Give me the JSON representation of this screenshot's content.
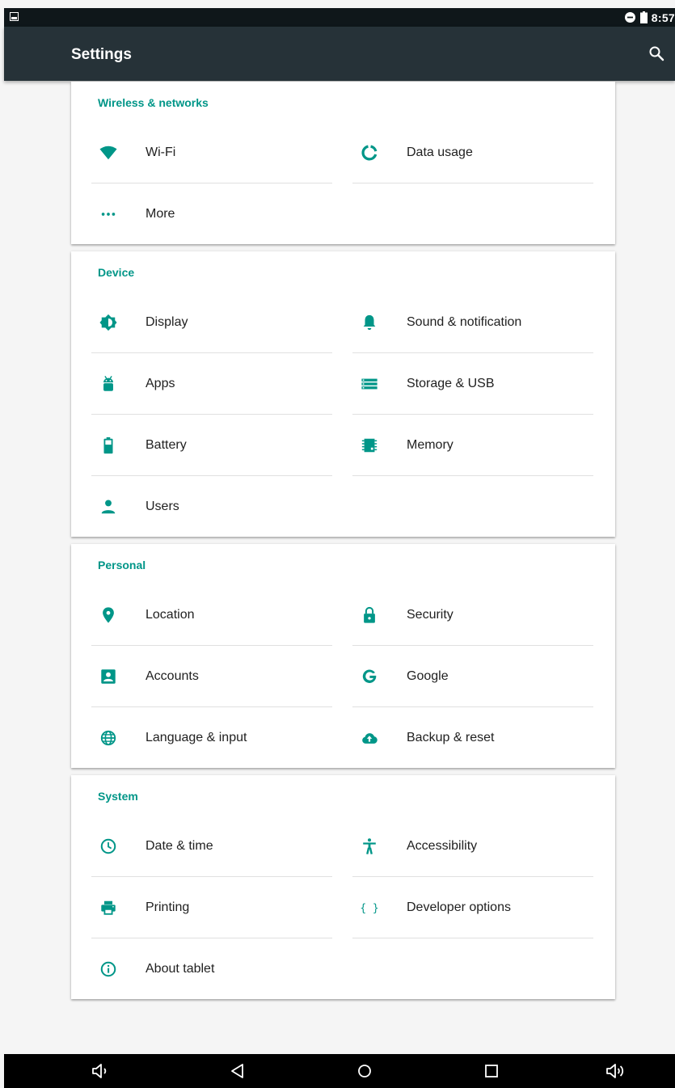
{
  "status_bar": {
    "time": "8:57",
    "icons": [
      "image-icon",
      "do-not-disturb-icon",
      "battery-icon"
    ]
  },
  "app_bar": {
    "title": "Settings",
    "search_icon": "search-icon"
  },
  "accent_color": "#009688",
  "sections": [
    {
      "title": "Wireless & networks",
      "items": [
        {
          "label": "Wi-Fi",
          "icon": "wifi-icon"
        },
        {
          "label": "Data usage",
          "icon": "data-usage-icon"
        },
        {
          "label": "More",
          "icon": "more-icon"
        }
      ]
    },
    {
      "title": "Device",
      "items": [
        {
          "label": "Display",
          "icon": "display-icon"
        },
        {
          "label": "Sound & notification",
          "icon": "bell-icon"
        },
        {
          "label": "Apps",
          "icon": "android-icon"
        },
        {
          "label": "Storage & USB",
          "icon": "storage-icon"
        },
        {
          "label": "Battery",
          "icon": "battery-icon"
        },
        {
          "label": "Memory",
          "icon": "memory-icon"
        },
        {
          "label": "Users",
          "icon": "user-icon"
        }
      ]
    },
    {
      "title": "Personal",
      "items": [
        {
          "label": "Location",
          "icon": "location-icon"
        },
        {
          "label": "Security",
          "icon": "lock-icon"
        },
        {
          "label": "Accounts",
          "icon": "account-icon"
        },
        {
          "label": "Google",
          "icon": "google-icon"
        },
        {
          "label": "Language & input",
          "icon": "globe-icon"
        },
        {
          "label": "Backup & reset",
          "icon": "cloud-upload-icon"
        }
      ]
    },
    {
      "title": "System",
      "items": [
        {
          "label": "Date & time",
          "icon": "clock-icon"
        },
        {
          "label": "Accessibility",
          "icon": "accessibility-icon"
        },
        {
          "label": "Printing",
          "icon": "printer-icon"
        },
        {
          "label": "Developer options",
          "icon": "braces-icon"
        },
        {
          "label": "About tablet",
          "icon": "info-icon"
        }
      ]
    }
  ],
  "nav_bar": [
    "volume-down-icon",
    "back-icon",
    "home-icon",
    "recents-icon",
    "volume-up-icon"
  ]
}
